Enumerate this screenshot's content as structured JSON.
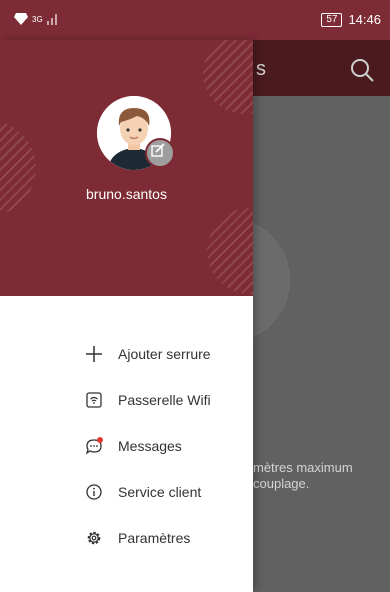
{
  "status_bar": {
    "network": "3G",
    "battery": "57",
    "time": "14:46"
  },
  "app_background": {
    "title_fragment": "s",
    "hint_text": "mètres maximum\ncouplage."
  },
  "drawer": {
    "username": "bruno.santos",
    "items": [
      {
        "label": "Ajouter serrure",
        "icon": "plus-icon"
      },
      {
        "label": "Passerelle Wifi",
        "icon": "wifi-gateway-icon"
      },
      {
        "label": "Messages",
        "icon": "message-icon"
      },
      {
        "label": "Service client",
        "icon": "info-icon"
      },
      {
        "label": "Paramètres",
        "icon": "gear-icon"
      }
    ]
  },
  "colors": {
    "header": "#7d2b35",
    "toolbar_dimmed": "#4a1a1f",
    "notification_dot": "#e53935"
  }
}
